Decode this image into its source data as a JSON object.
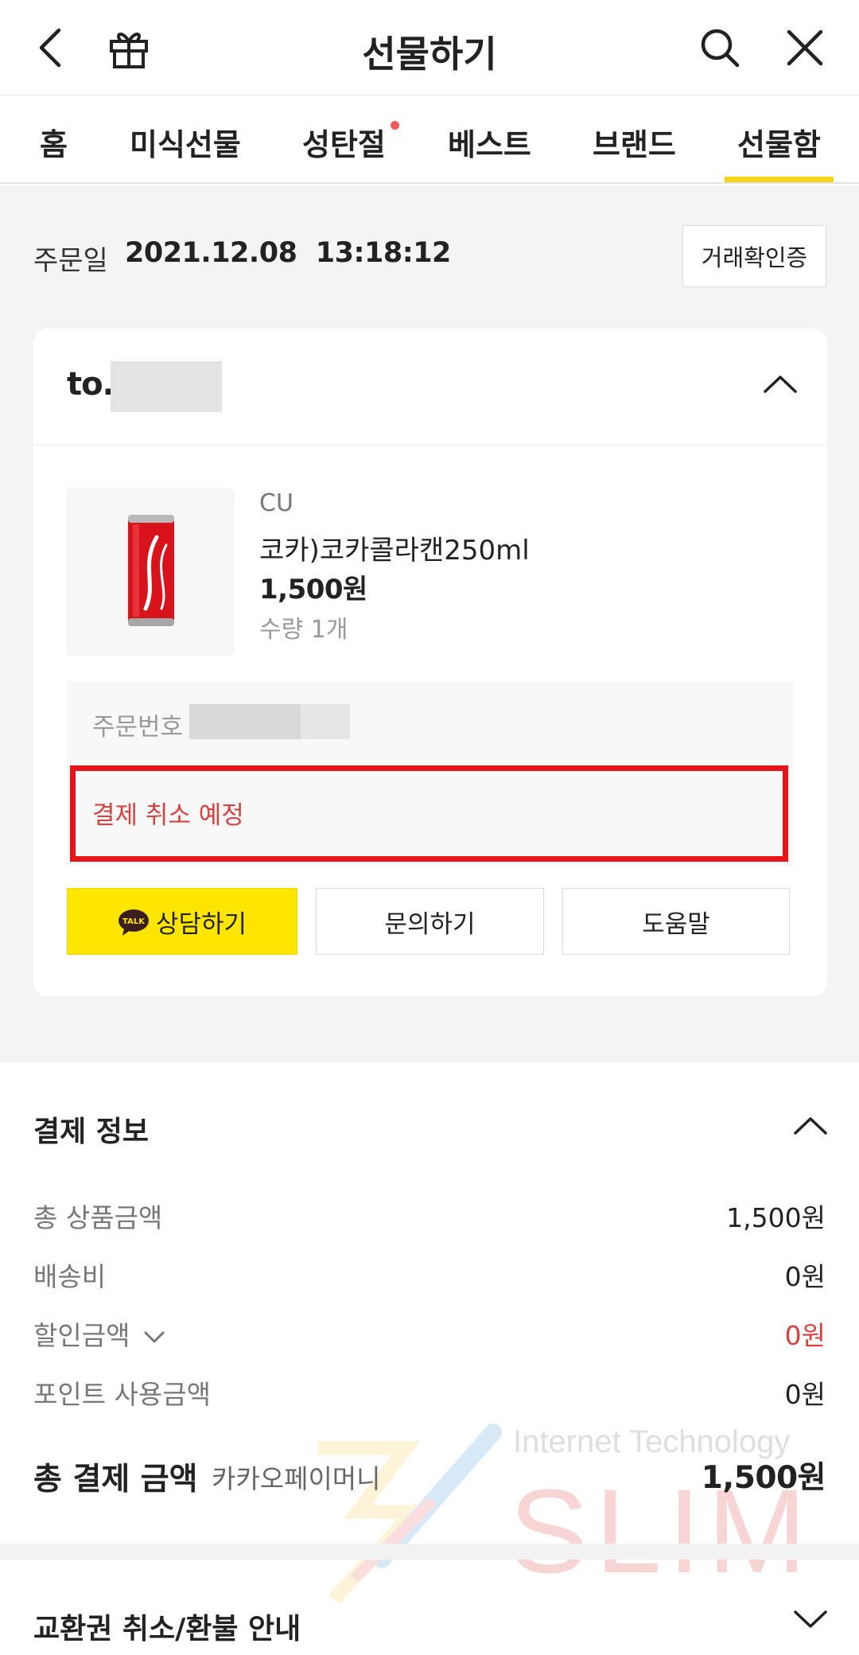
{
  "header": {
    "title": "선물하기",
    "back_icon": "chevron-left-icon",
    "gift_icon": "gift-icon",
    "search_icon": "search-icon",
    "close_icon": "close-icon"
  },
  "tabs": [
    {
      "label": "홈",
      "has_dot": false,
      "active": false
    },
    {
      "label": "미식선물",
      "has_dot": false,
      "active": false
    },
    {
      "label": "성탄절",
      "has_dot": true,
      "active": false
    },
    {
      "label": "베스트",
      "has_dot": false,
      "active": false
    },
    {
      "label": "브랜드",
      "has_dot": false,
      "active": false
    },
    {
      "label": "선물함",
      "has_dot": false,
      "active": true
    }
  ],
  "colors": {
    "accent_yellow": "#f7d417",
    "talk_yellow": "#fee500",
    "alert_red": "#d94040",
    "highlight_red": "#e8141c",
    "dot_red": "#f05a5a"
  },
  "order": {
    "date_label": "주문일",
    "date_value": "2021.12.08  13:18:12",
    "cert_button": "거래확인증",
    "recipient_prefix": "to.",
    "brand": "CU",
    "product_name": "코카)코카콜라캔250ml",
    "price": "1,500원",
    "quantity": "수량 1개",
    "order_number_label": "주문번호",
    "status": "결제 취소 예정"
  },
  "actions": {
    "talk_badge": "TALK",
    "consult": "상담하기",
    "inquiry": "문의하기",
    "help": "도움말"
  },
  "payment": {
    "title": "결제 정보",
    "rows": [
      {
        "label": "총 상품금액",
        "value": "1,500원"
      },
      {
        "label": "배송비",
        "value": "0원"
      },
      {
        "label": "할인금액",
        "value": "0원"
      },
      {
        "label": "포인트 사용금액",
        "value": "0원"
      }
    ],
    "total_label": "총 결제 금액",
    "total_method": "카카오페이머니",
    "total_value": "1,500원"
  },
  "refund": {
    "title": "교환권 취소/환불 안내"
  },
  "watermark": {
    "line1": "Internet Technology",
    "line2": "SLIM"
  }
}
